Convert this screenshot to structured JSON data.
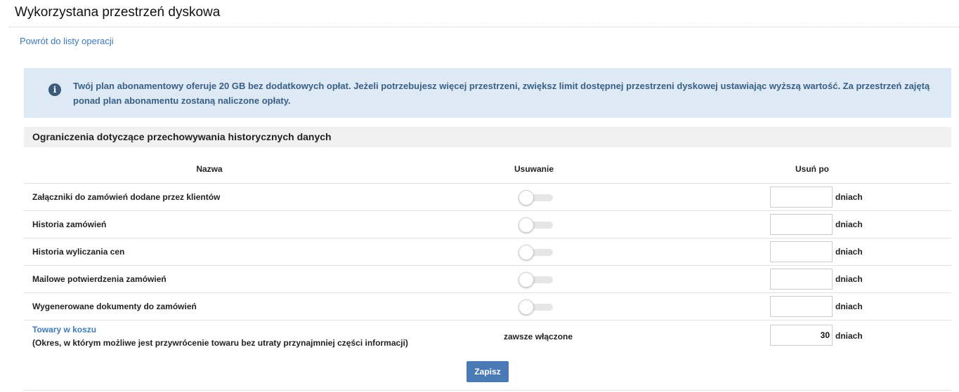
{
  "page": {
    "title": "Wykorzystana przestrzeń dyskowa",
    "back_link": "Powrót do listy operacji"
  },
  "info": {
    "icon": "info-icon",
    "icon_glyph": "i",
    "text": "Twój plan abonamentowy oferuje 20 GB bez dodatkowych opłat. Jeżeli potrzebujesz więcej przestrzeni, zwiększ limit dostępnej przestrzeni dyskowej ustawiając wyższą wartość. Za przestrzeń zajętą ponad plan abonamentu zostaną naliczone opłaty."
  },
  "section": {
    "title": "Ograniczenia dotyczące przechowywania historycznych danych",
    "columns": {
      "name": "Nazwa",
      "removal": "Usuwanie",
      "remove_after": "Usuń po"
    },
    "unit": "dniach",
    "rows": [
      {
        "label": "Załączniki do zamówień dodane przez klientów",
        "enabled": false,
        "days": ""
      },
      {
        "label": "Historia zamówień",
        "enabled": false,
        "days": ""
      },
      {
        "label": "Historia wyliczania cen",
        "enabled": false,
        "days": ""
      },
      {
        "label": "Mailowe potwierdzenia zamówień",
        "enabled": false,
        "days": ""
      },
      {
        "label": "Wygenerowane dokumenty do zamówień",
        "enabled": false,
        "days": ""
      }
    ],
    "special_row": {
      "link": "Towary w koszu",
      "description": "(Okres, w którym możliwe jest przywrócenie towaru bez utraty przynajmniej części informacji)",
      "status": "zawsze włączone",
      "days": "30"
    }
  },
  "actions": {
    "save_label": "Zapisz"
  },
  "colors": {
    "accent": "#4a7ab5",
    "link": "#3d7ab8",
    "info_bg": "#dde9f4",
    "info_text": "#3a5f86"
  }
}
